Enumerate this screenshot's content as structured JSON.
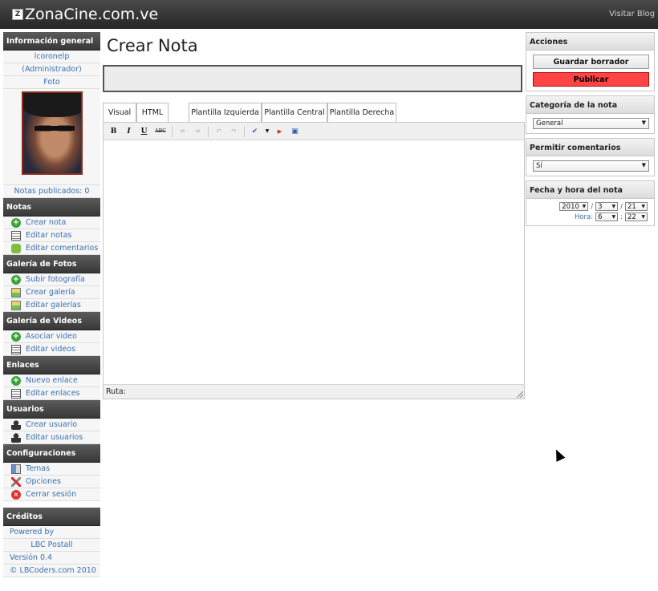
{
  "header": {
    "site_title": "ZonaCine.com.ve",
    "visit_link": "Visitar Blog"
  },
  "sidebar": {
    "info_title": "Información general",
    "user_name": "lcoronelp",
    "user_role": "(Administrador)",
    "photo_label": "Foto",
    "published": "Notas publicados: 0",
    "sections": [
      {
        "title": "Notas",
        "items": [
          {
            "label": "Crear nota",
            "icon": "add-icon"
          },
          {
            "label": "Editar notas",
            "icon": "list-icon"
          },
          {
            "label": "Editar comentarios",
            "icon": "comment-icon"
          }
        ]
      },
      {
        "title": "Galería de Fotos",
        "items": [
          {
            "label": "Subir fotografía",
            "icon": "add-icon"
          },
          {
            "label": "Crear galería",
            "icon": "gallery-icon"
          },
          {
            "label": "Editar galerías",
            "icon": "gallery-icon"
          }
        ]
      },
      {
        "title": "Galería de Videos",
        "items": [
          {
            "label": "Asociar video",
            "icon": "add-icon"
          },
          {
            "label": "Editar videos",
            "icon": "list-icon"
          }
        ]
      },
      {
        "title": "Enlaces",
        "items": [
          {
            "label": "Nuevo enlace",
            "icon": "add-icon"
          },
          {
            "label": "Editar enlaces",
            "icon": "list-icon"
          }
        ]
      },
      {
        "title": "Usuarios",
        "items": [
          {
            "label": "Crear usuario",
            "icon": "user-add-icon"
          },
          {
            "label": "Editar usuarios",
            "icon": "user-icon"
          }
        ]
      },
      {
        "title": "Configuraciones",
        "items": [
          {
            "label": "Temas",
            "icon": "theme-icon"
          },
          {
            "label": "Opciones",
            "icon": "tools-icon"
          },
          {
            "label": "Cerrar sesión",
            "icon": "logout-icon"
          }
        ]
      }
    ],
    "credits": {
      "title": "Créditos",
      "powered": "Powered by",
      "product": "LBC Postall",
      "version": "Versión 0.4",
      "copyright": "© LBCoders.com 2010"
    }
  },
  "main": {
    "title": "Crear Nota",
    "tabs": [
      "Visual",
      "HTML",
      "Plantilla Izquierda",
      "Plantilla Central",
      "Plantilla Derecha"
    ],
    "toolbar": {
      "bold": "B",
      "italic": "I",
      "underline": "U",
      "strike": "ABC"
    },
    "status_path": "Ruta:"
  },
  "right": {
    "actions_title": "Acciones",
    "save_label": "Guardar borrador",
    "publish_label": "Publicar",
    "category_title": "Categoría de la nota",
    "category_value": "General",
    "comments_title": "Permitir comentarios",
    "comments_value": "Sí",
    "date_title": "Fecha y hora del nota",
    "year": "2010",
    "month": "3",
    "day": "21",
    "hora_label": "Hora:",
    "hour": "6",
    "minute": "22"
  }
}
